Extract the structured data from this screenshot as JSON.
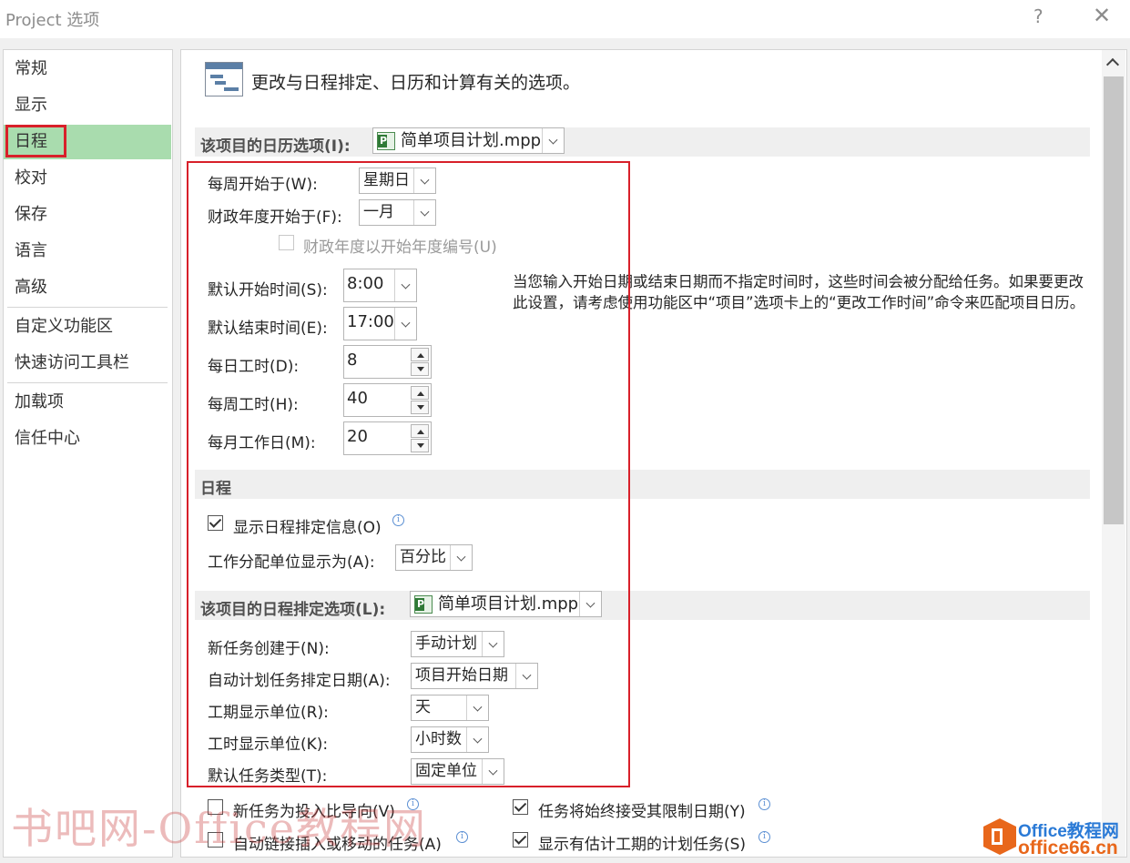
{
  "window": {
    "title": "Project 选项",
    "help": "?",
    "close": "✕"
  },
  "sidebar": {
    "items": [
      {
        "label": "常规"
      },
      {
        "label": "显示"
      },
      {
        "label": "日程",
        "selected": true
      },
      {
        "label": "校对"
      },
      {
        "label": "保存"
      },
      {
        "label": "语言"
      },
      {
        "label": "高级"
      },
      {
        "label": "自定义功能区"
      },
      {
        "label": "快速访问工具栏"
      },
      {
        "label": "加载项"
      },
      {
        "label": "信任中心"
      }
    ]
  },
  "header": {
    "icon": "gantt-chart-icon",
    "text": "更改与日程排定、日历和计算有关的选项。"
  },
  "calendar_section": {
    "label": "该项目的日历选项(I):",
    "project": "简单项目计划.mpp",
    "week_starts_label": "每周开始于(W):",
    "week_starts_value": "星期日",
    "fiscal_year_label": "财政年度开始于(F):",
    "fiscal_year_value": "一月",
    "fiscal_numbering_label": "财政年度以开始年度编号(U)",
    "default_start_label": "默认开始时间(S):",
    "default_start_value": "8:00",
    "default_end_label": "默认结束时间(E):",
    "default_end_value": "17:00",
    "hours_per_day_label": "每日工时(D):",
    "hours_per_day_value": "8",
    "hours_per_week_label": "每周工时(H):",
    "hours_per_week_value": "40",
    "days_per_month_label": "每月工作日(M):",
    "days_per_month_value": "20",
    "note": "当您输入开始日期或结束日期而不指定时间时，这些时间会被分配给任务。如果要更改此设置，请考虑使用功能区中“项目”选项卡上的“更改工作时间”命令来匹配项目日历。"
  },
  "schedule_section": {
    "label": "日程",
    "show_info_label": "显示日程排定信息(O)",
    "show_info_checked": true,
    "assignment_units_label": "工作分配单位显示为(A):",
    "assignment_units_value": "百分比"
  },
  "scheduling_options": {
    "label": "该项目的日程排定选项(L):",
    "project": "简单项目计划.mpp",
    "new_tasks_label": "新任务创建于(N):",
    "new_tasks_value": "手动计划",
    "auto_schedule_label": "自动计划任务排定日期(A):",
    "auto_schedule_value": "项目开始日期",
    "duration_unit_label": "工期显示单位(R):",
    "duration_unit_value": "天",
    "work_unit_label": "工时显示单位(K):",
    "work_unit_value": "小时数",
    "task_type_label": "默认任务类型(T):",
    "task_type_value": "固定单位",
    "effort_driven_label": "新任务为投入比导向(V)",
    "effort_driven_checked": false,
    "autolink_label": "自动链接插入或移动的任务(A)",
    "autolink_checked": false,
    "honor_constraints_label": "任务将始终接受其限制日期(Y)",
    "honor_constraints_checked": true,
    "show_estimated_label": "显示有估计工期的计划任务(S)",
    "show_estimated_checked": true
  },
  "watermark": {
    "left_text": "书吧网-Office教程网",
    "logo_line1": "Office教程网",
    "logo_line2": "office66.cn"
  },
  "colors": {
    "selected_nav": "#a9dcae",
    "highlight_border": "#d8202a"
  }
}
